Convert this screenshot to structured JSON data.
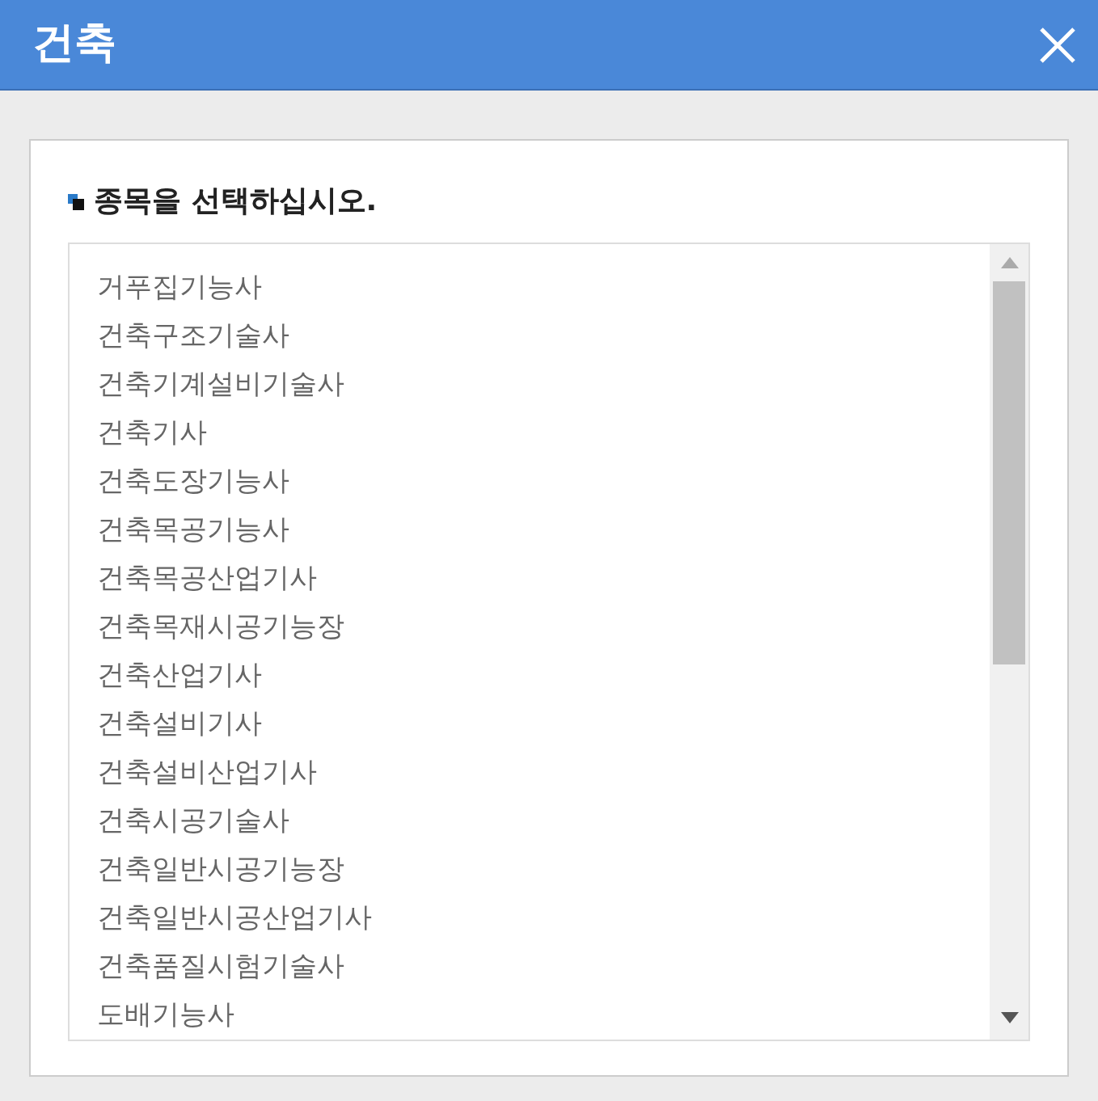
{
  "window": {
    "title": "건축"
  },
  "prompt": "종목을 선택하십시오.",
  "items": [
    {
      "label": "거푸집기능사",
      "selected": false
    },
    {
      "label": "건축구조기술사",
      "selected": false
    },
    {
      "label": "건축기계설비기술사",
      "selected": false
    },
    {
      "label": "건축기사",
      "selected": false
    },
    {
      "label": "건축도장기능사",
      "selected": false
    },
    {
      "label": "건축목공기능사",
      "selected": false
    },
    {
      "label": "건축목공산업기사",
      "selected": false
    },
    {
      "label": "건축목재시공기능장",
      "selected": false
    },
    {
      "label": "건축산업기사",
      "selected": false
    },
    {
      "label": "건축설비기사",
      "selected": false
    },
    {
      "label": "건축설비산업기사",
      "selected": false
    },
    {
      "label": "건축시공기술사",
      "selected": false
    },
    {
      "label": "건축일반시공기능장",
      "selected": false
    },
    {
      "label": "건축일반시공산업기사",
      "selected": false
    },
    {
      "label": "건축품질시험기술사",
      "selected": false
    },
    {
      "label": "도배기능사",
      "selected": false
    }
  ]
}
